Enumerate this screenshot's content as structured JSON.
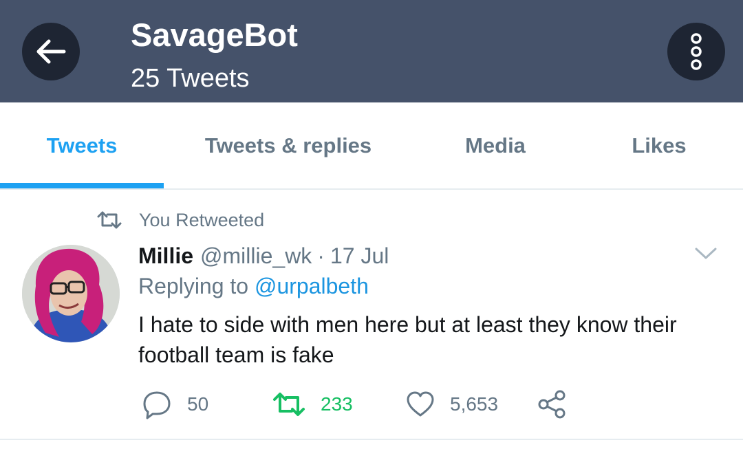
{
  "header": {
    "title": "SavageBot",
    "subtitle": "25 Tweets",
    "back_icon": "arrow-left-icon",
    "menu_icon": "more-vertical-icon"
  },
  "tabs": [
    {
      "label": "Tweets",
      "active": true
    },
    {
      "label": "Tweets & replies",
      "active": false
    },
    {
      "label": "Media",
      "active": false
    },
    {
      "label": "Likes",
      "active": false
    }
  ],
  "tweet": {
    "retweet_note": "You Retweeted",
    "author_name": "Millie",
    "author_handle": "@millie_wk",
    "separator": "·",
    "date": "17 Jul",
    "replying_prefix": "Replying to",
    "replying_to": "@urpalbeth",
    "text": "I hate to side with men here but at least they know their football team is fake",
    "replies": "50",
    "retweets": "233",
    "likes": "5,653"
  },
  "colors": {
    "header_bg": "#45526a",
    "accent": "#1da1f2",
    "retweet_green": "#17bf63",
    "muted": "#657786"
  }
}
